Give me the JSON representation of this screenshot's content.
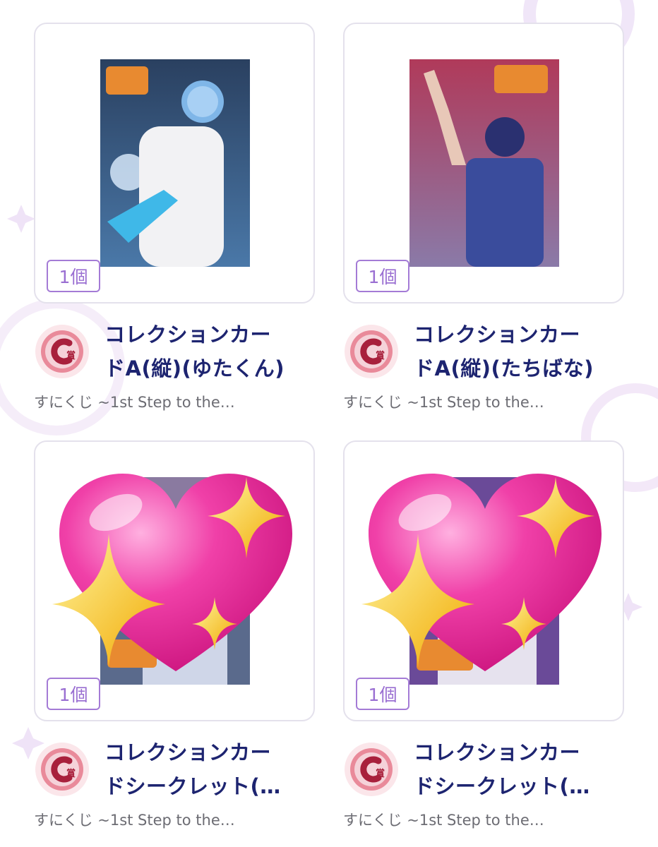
{
  "items": [
    {
      "count": "1個",
      "title_line1": "コレクションカー",
      "title_line2": "ドA(縦)(ゆたくん)",
      "subtitle": "すにくじ ~1st Step to the…",
      "prize": "C賞",
      "photo_bg": "#3a5a8c",
      "covered": false
    },
    {
      "count": "1個",
      "title_line1": "コレクションカー",
      "title_line2": "ドA(縦)(たちばな)",
      "subtitle": "すにくじ ~1st Step to the…",
      "prize": "C賞",
      "photo_bg": "#8a5a8c",
      "covered": false
    },
    {
      "count": "1個",
      "title_line1": "コレクションカー",
      "title_line2": "ドシークレット(…",
      "subtitle": "すにくじ ~1st Step to the…",
      "prize": "C賞",
      "photo_bg": "#6a6a8c",
      "covered": true
    },
    {
      "count": "1個",
      "title_line1": "コレクションカー",
      "title_line2": "ドシークレット(…",
      "subtitle": "すにくじ ~1st Step to the…",
      "prize": "C賞",
      "photo_bg": "#7a5aa0",
      "covered": true
    }
  ],
  "colors": {
    "title": "#1d2470",
    "badge_border": "#a47bd6",
    "badge_text": "#9a6fd2",
    "subtitle": "#6c6c73",
    "prize_icon": "#b0304a"
  },
  "icons": {
    "prize": "c-prize-medal-icon",
    "overlay": "sparkling-heart-icon"
  }
}
